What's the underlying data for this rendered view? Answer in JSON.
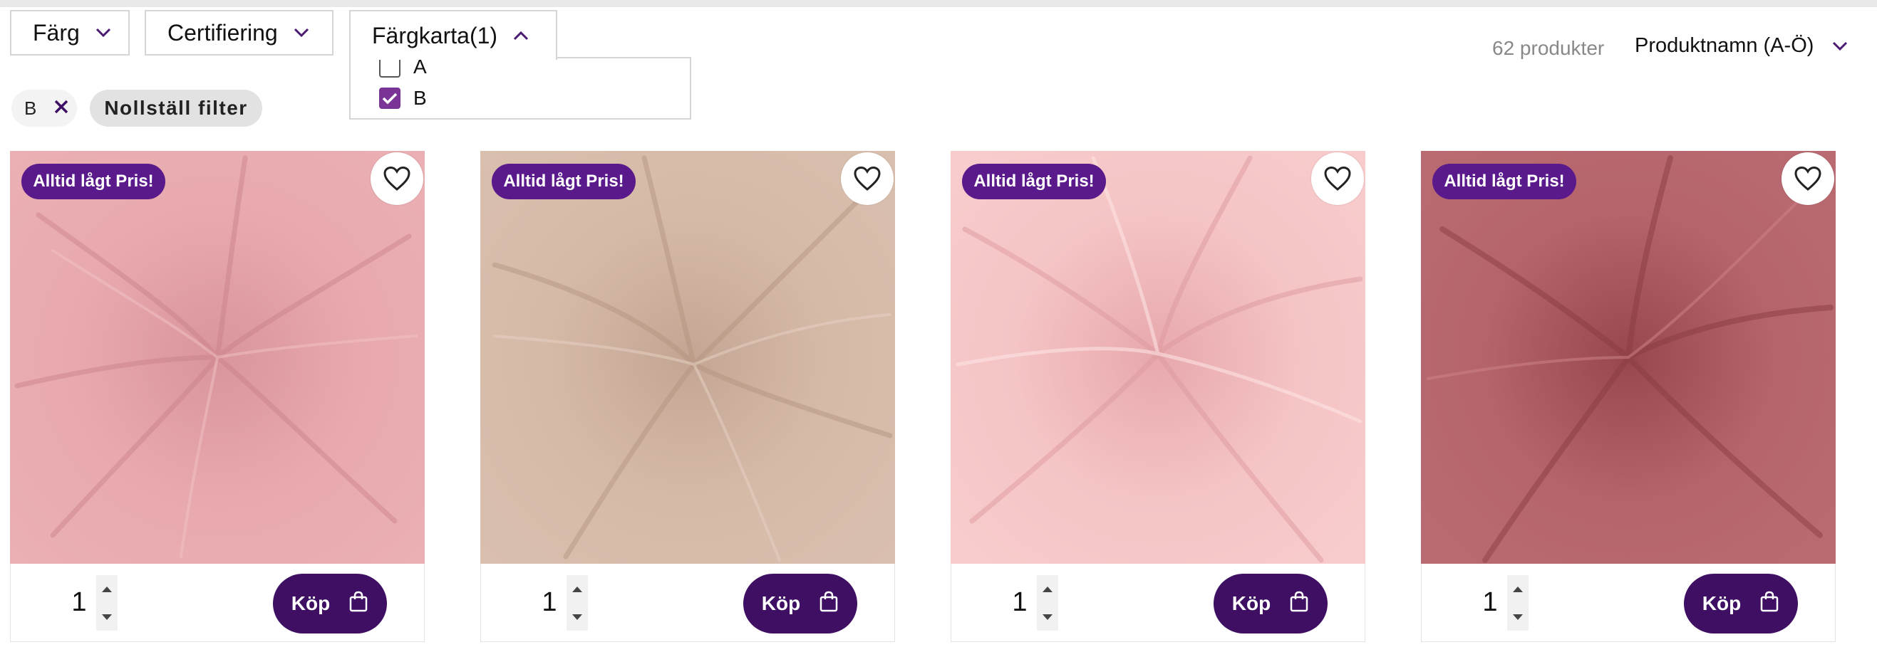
{
  "filters": [
    {
      "label": "Färg",
      "open": false
    },
    {
      "label": "Certifiering",
      "open": false
    },
    {
      "label": "Färgkarta(1)",
      "open": true
    }
  ],
  "dropdown": {
    "options": [
      {
        "label": "A",
        "checked": false
      },
      {
        "label": "B",
        "checked": true
      }
    ]
  },
  "results": {
    "count": "62 produkter"
  },
  "sort": {
    "label": "Produktnamn (A-Ö)"
  },
  "active_filters": [
    {
      "label": "B"
    }
  ],
  "reset_label": "Nollställ filter",
  "colors": {
    "badge": "#5b1a8c",
    "buy_button": "#3f0f63",
    "checkbox": "#7a3496"
  },
  "products": [
    {
      "badge": "Alltid lågt Pris!",
      "quantity": "1",
      "buy_label": "Köp",
      "fabric_color": "#e8a9ae"
    },
    {
      "badge": "Alltid lågt Pris!",
      "quantity": "1",
      "buy_label": "Köp",
      "fabric_color": "#d6baa8"
    },
    {
      "badge": "Alltid lågt Pris!",
      "quantity": "1",
      "buy_label": "Köp",
      "fabric_color": "#f5c4c5"
    },
    {
      "badge": "Alltid lågt Pris!",
      "quantity": "1",
      "buy_label": "Köp",
      "fabric_color": "#b5646c"
    }
  ]
}
